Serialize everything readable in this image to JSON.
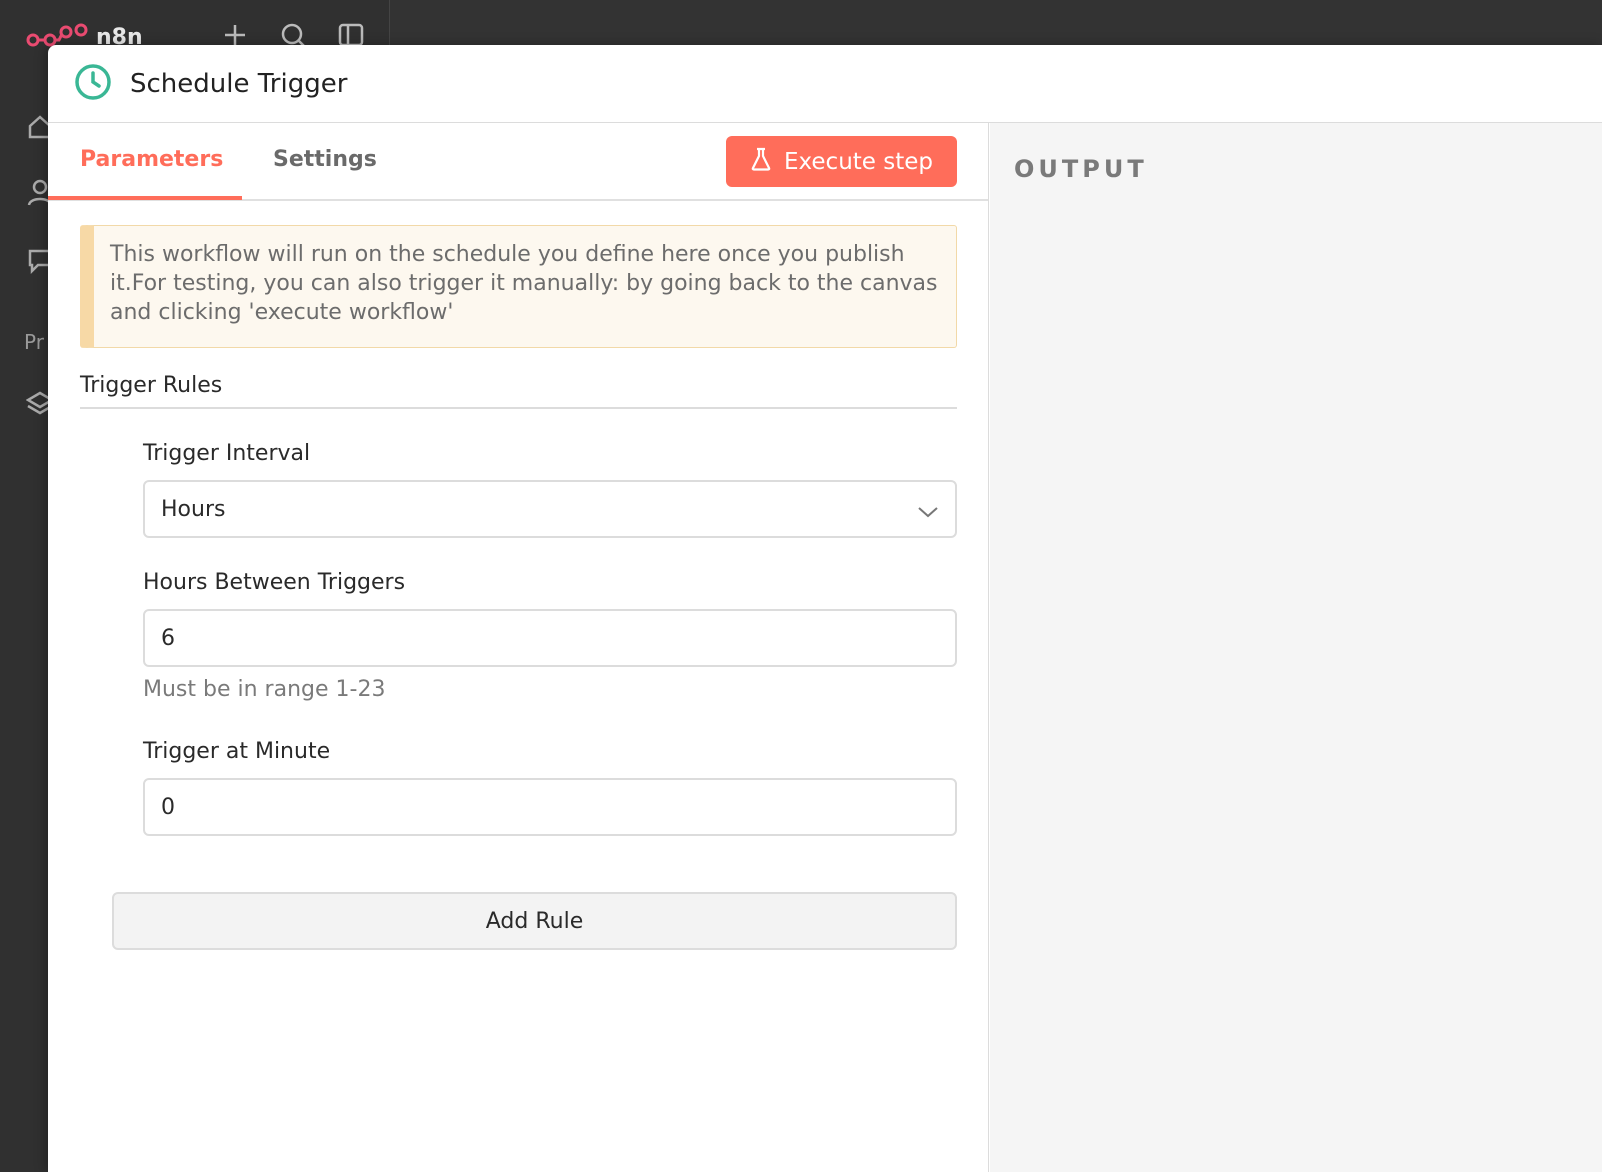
{
  "background": {
    "logo_text": "n8n",
    "sidebar_partial_text": "Pr",
    "icons": [
      "plus-icon",
      "search-icon",
      "panel-icon",
      "home-icon",
      "users-icon",
      "chat-icon",
      "layers-icon"
    ]
  },
  "modal": {
    "title": "Schedule Trigger",
    "title_icon": "clock-icon",
    "accent_color": "#ff6d5a",
    "icon_color": "#3ab795"
  },
  "tabs": [
    {
      "label": "Parameters",
      "active": true
    },
    {
      "label": "Settings",
      "active": false
    }
  ],
  "execute_button": {
    "label": "Execute step",
    "icon": "flask-icon"
  },
  "notice": {
    "text": "This workflow will run on the schedule you define here once you publish it.For testing, you can also trigger it manually: by going back to the canvas and clicking 'execute workflow'"
  },
  "trigger_rules": {
    "title": "Trigger Rules",
    "fields": {
      "interval": {
        "label": "Trigger Interval",
        "value": "Hours"
      },
      "hours_between": {
        "label": "Hours Between Triggers",
        "value": "6",
        "hint": "Must be in range 1-23"
      },
      "minute": {
        "label": "Trigger at Minute",
        "value": "0"
      }
    },
    "add_rule_label": "Add Rule"
  },
  "output": {
    "title": "OUTPUT"
  }
}
